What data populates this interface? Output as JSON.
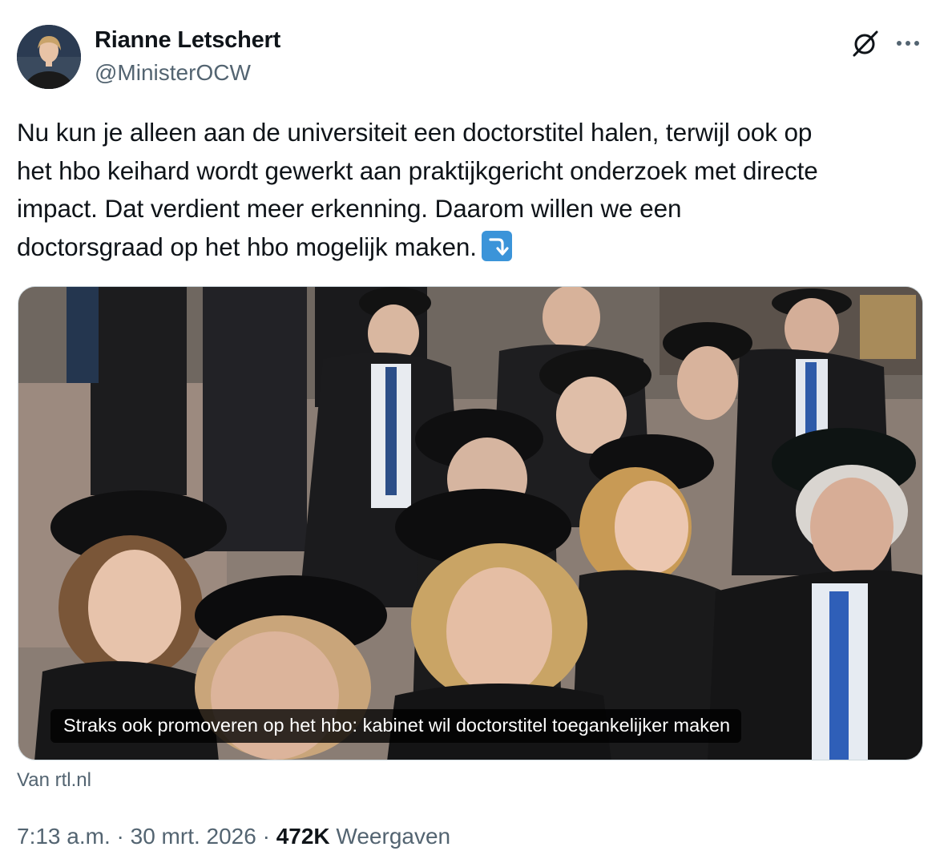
{
  "author": {
    "display_name": "Rianne Letschert",
    "handle": "@MinisterOCW"
  },
  "tweet": {
    "lines": [
      "Nu kun je alleen aan de universiteit een doctorstitel halen, terwijl ook op",
      "het hbo keihard wordt gewerkt aan praktijkgericht onderzoek met directe",
      "impact. Dat verdient meer erkenning. Daarom willen we een",
      "doctorsgraad op het hbo mogelijk maken."
    ],
    "emoji": "right-arrow-curving-down-emoji"
  },
  "card": {
    "caption": "Straks ook promoveren op het hbo: kabinet wil doctorstitel toegankelijker maken",
    "source": "Van rtl.nl"
  },
  "meta": {
    "time": "7:13 a.m.",
    "separator1": " · ",
    "date": "30 mrt. 2026",
    "separator2": " · ",
    "views_count": "472K",
    "views_label": " Weergaven"
  },
  "icons": {
    "grok": "grok-icon",
    "more": "more-icon"
  },
  "colors": {
    "text": "#0f1419",
    "secondary": "#536471",
    "emoji_blue": "#3b94d9"
  }
}
